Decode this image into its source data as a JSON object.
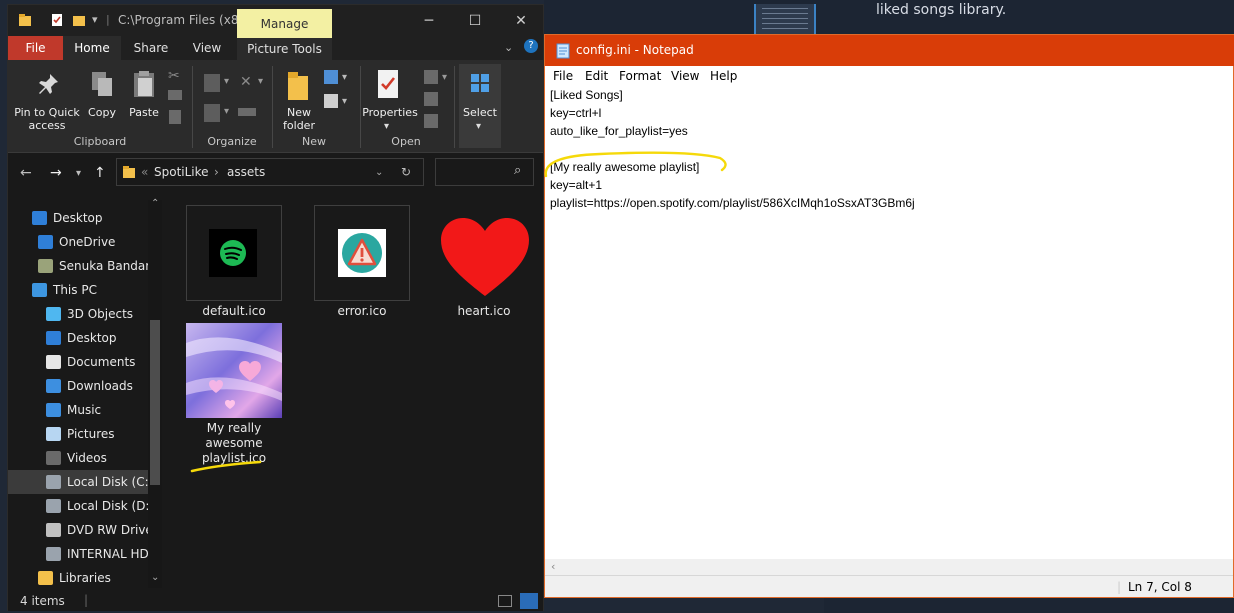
{
  "background": {
    "caption": "liked songs library."
  },
  "explorer": {
    "title": "C:\\Program Files (x8...",
    "contextual_tab": "Manage",
    "tabs": [
      "File",
      "Home",
      "Share",
      "View",
      "Picture Tools"
    ],
    "ribbon": {
      "clipboard": {
        "label": "Clipboard",
        "pin": "Pin to Quick access",
        "copy": "Copy",
        "paste": "Paste"
      },
      "organize": {
        "label": "Organize"
      },
      "new": {
        "label": "New",
        "new_folder": "New folder"
      },
      "open": {
        "label": "Open",
        "properties": "Properties"
      },
      "select": {
        "label": "Select"
      }
    },
    "breadcrumb": [
      "SpotiLike",
      "assets"
    ],
    "nav_items": [
      {
        "label": "Desktop",
        "icon": "desktop-icon"
      },
      {
        "label": "OneDrive",
        "icon": "cloud-icon"
      },
      {
        "label": "Senuka Bandara",
        "icon": "user-icon"
      },
      {
        "label": "This PC",
        "icon": "computer-icon"
      },
      {
        "label": "3D Objects",
        "icon": "cube-icon"
      },
      {
        "label": "Desktop",
        "icon": "desktop-icon"
      },
      {
        "label": "Documents",
        "icon": "document-icon"
      },
      {
        "label": "Downloads",
        "icon": "download-arrow-icon"
      },
      {
        "label": "Music",
        "icon": "music-note-icon"
      },
      {
        "label": "Pictures",
        "icon": "picture-icon"
      },
      {
        "label": "Videos",
        "icon": "film-icon"
      },
      {
        "label": "Local Disk (C:)",
        "icon": "drive-icon"
      },
      {
        "label": "Local Disk (D:)",
        "icon": "drive-icon"
      },
      {
        "label": "DVD RW Drive",
        "icon": "dvd-icon"
      },
      {
        "label": "INTERNAL HDD",
        "icon": "drive-icon"
      },
      {
        "label": "Libraries",
        "icon": "library-icon"
      }
    ],
    "files": [
      {
        "name": "default.ico",
        "icon": "spotify-icon"
      },
      {
        "name": "error.ico",
        "icon": "warning-icon"
      },
      {
        "name": "heart.ico",
        "icon": "heart-icon"
      },
      {
        "name_lines": [
          "My really",
          "awesome",
          "playlist.ico"
        ],
        "icon": "playlist-image-icon"
      }
    ],
    "status": "4 items",
    "colors": {
      "file_tab": "#c0392b",
      "manage": "#f3f0a3"
    }
  },
  "notepad": {
    "title": "config.ini - Notepad",
    "menu": [
      "File",
      "Edit",
      "Format",
      "View",
      "Help"
    ],
    "lines": [
      "[Liked Songs]",
      "key=ctrl+l",
      "auto_like_for_playlist=yes",
      "",
      "[My really awesome playlist]",
      "key=alt+1",
      "playlist=https://open.spotify.com/playlist/586XcIMqh1oSsxAT3GBm6j"
    ],
    "status": "Ln 7, Col 8",
    "colors": {
      "titlebar": "#d93d08",
      "highlight": "#f5d90a"
    }
  }
}
